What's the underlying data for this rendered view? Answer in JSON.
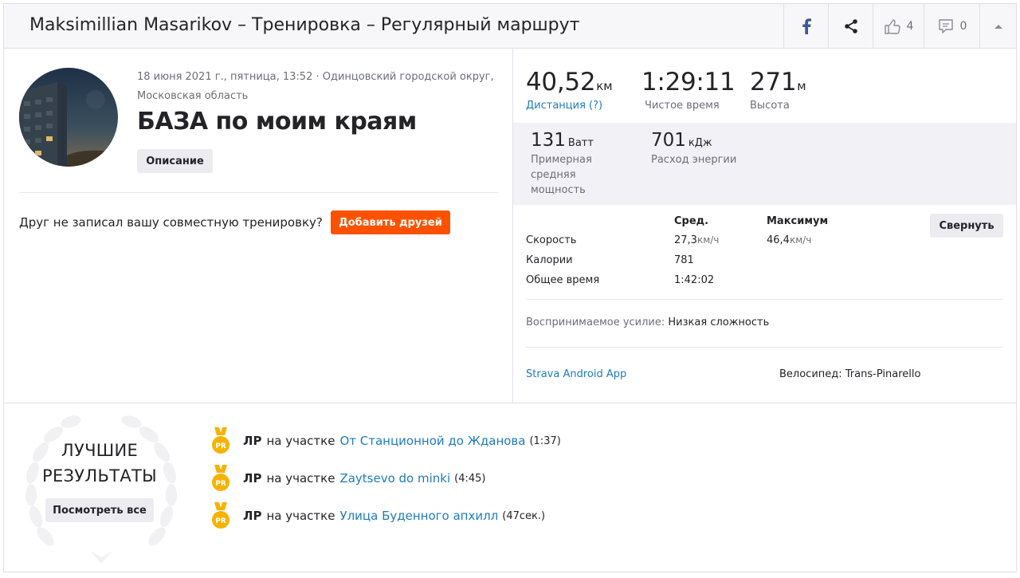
{
  "header": {
    "title": "Maksimillian Masarikov – Тренировка – Регулярный маршрут",
    "kudos_count": "4",
    "comments_count": "0",
    "icons": [
      "facebook-icon",
      "share-icon",
      "kudos-icon",
      "comment-icon",
      "collapse-up-icon"
    ]
  },
  "activity": {
    "date_line1": "18 июня 2021 г., пятница, 13:52 · Одинцовский городской округ,",
    "date_line2": "Московская область",
    "title": "БАЗА по моим краям",
    "description_label": "Описание",
    "friend_question": "Друг не записал вашу совместную тренировку?",
    "add_friends_label": "Добавить друзей"
  },
  "stats": {
    "distance": {
      "value": "40,52",
      "unit": "км",
      "label": "Дистанция (?)"
    },
    "moving_time": {
      "value": "1:29:11",
      "label": "Чистое время"
    },
    "elevation": {
      "value": "271",
      "unit": "м",
      "label": "Высота"
    },
    "power": {
      "value": "131",
      "unit": "Ватт",
      "label1": "Примерная",
      "label2": "средняя",
      "label3": "мощность"
    },
    "energy": {
      "value": "701",
      "unit": "кДж",
      "label": "Расход энергии"
    }
  },
  "table": {
    "col_avg": "Сред.",
    "col_max": "Максимум",
    "collapse_label": "Свернуть",
    "rows": [
      {
        "name": "Скорость",
        "avg": "27,3",
        "avg_unit": "км/ч",
        "max": "46,4",
        "max_unit": "км/ч"
      },
      {
        "name": "Калории",
        "avg": "781",
        "avg_unit": "",
        "max": "",
        "max_unit": ""
      },
      {
        "name": "Общее время",
        "avg": "1:42:02",
        "avg_unit": "",
        "max": "",
        "max_unit": ""
      }
    ]
  },
  "details": {
    "effort_label": "Воспринимаемое усилие:",
    "effort_value": "Низкая сложность",
    "app": "Strava Android App",
    "bike": "Велосипед: Trans-Pinarello"
  },
  "best": {
    "title_line1": "ЛУЧШИЕ",
    "title_line2": "РЕЗУЛЬТАТЫ",
    "view_all_label": "Посмотреть все",
    "medal_text": "PR",
    "colors": {
      "medal": "#f5b301",
      "link": "#1e7bbf",
      "accent": "#fc5200"
    },
    "items": [
      {
        "badge": "ЛР",
        "on": "на участке",
        "segment": "От Станционной до Жданова",
        "time": "(1:37)"
      },
      {
        "badge": "ЛР",
        "on": "на участке",
        "segment": "Zaytsevo do minki",
        "time": "(4:45)"
      },
      {
        "badge": "ЛР",
        "on": "на участке",
        "segment": "Улица Буденного апхилл",
        "time": "(47сек.)"
      }
    ]
  }
}
